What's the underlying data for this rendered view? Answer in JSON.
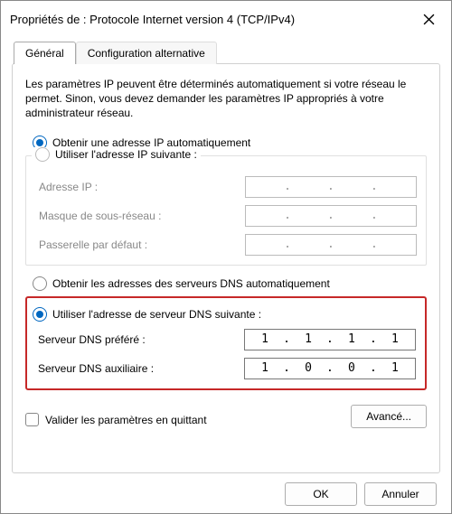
{
  "title": "Propriétés de : Protocole Internet version 4 (TCP/IPv4)",
  "tabs": {
    "general": "Général",
    "alt": "Configuration alternative"
  },
  "intro": "Les paramètres IP peuvent être déterminés automatiquement si votre réseau le permet. Sinon, vous devez demander les paramètres IP appropriés à votre administrateur réseau.",
  "ip": {
    "auto": "Obtenir une adresse IP automatiquement",
    "manual": "Utiliser l'adresse IP suivante :",
    "address": "Adresse IP :",
    "mask": "Masque de sous-réseau :",
    "gateway": "Passerelle par défaut :"
  },
  "dns": {
    "auto": "Obtenir les adresses des serveurs DNS automatiquement",
    "manual": "Utiliser l'adresse de serveur DNS suivante :",
    "preferred": "Serveur DNS préféré :",
    "alternate": "Serveur DNS auxiliaire :",
    "preferred_value": [
      "1",
      "1",
      "1",
      "1"
    ],
    "alternate_value": [
      "1",
      "0",
      "0",
      "1"
    ]
  },
  "validate": "Valider les paramètres en quittant",
  "advanced": "Avancé...",
  "ok": "OK",
  "cancel": "Annuler"
}
